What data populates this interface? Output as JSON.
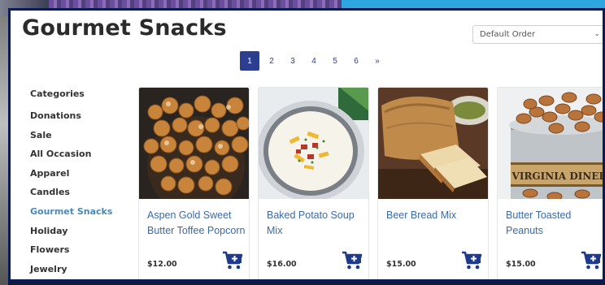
{
  "header": {
    "title": "Gourmet Snacks",
    "sort_select": {
      "value": "Default Order"
    }
  },
  "pagination": {
    "pages": [
      "1",
      "2",
      "3",
      "4",
      "5",
      "6"
    ],
    "current": "1",
    "next": "»"
  },
  "sidebar": {
    "heading": "Categories",
    "items": [
      {
        "label": "Donations",
        "active": false
      },
      {
        "label": "Sale",
        "active": false
      },
      {
        "label": "All Occasion",
        "active": false
      },
      {
        "label": "Apparel",
        "active": false
      },
      {
        "label": "Candles",
        "active": false
      },
      {
        "label": "Gourmet Snacks",
        "active": true
      },
      {
        "label": "Holiday",
        "active": false
      },
      {
        "label": "Flowers",
        "active": false
      },
      {
        "label": "Jewelry",
        "active": false
      }
    ]
  },
  "products": [
    {
      "name": "Aspen Gold Sweet Butter Toffee Popcorn",
      "price": "$12.00",
      "image": "popcorn-image",
      "cart_icon": "add-to-cart-icon"
    },
    {
      "name": "Baked Potato Soup Mix",
      "price": "$16.00",
      "image": "potato-soup-image",
      "cart_icon": "add-to-cart-icon"
    },
    {
      "name": "Beer Bread Mix",
      "price": "$15.00",
      "image": "beer-bread-image",
      "cart_icon": "add-to-cart-icon"
    },
    {
      "name": "Butter Toasted Peanuts",
      "price": "$15.00",
      "image": "peanuts-tin-image",
      "label_text": "VIRGINIA DINER",
      "cart_icon": "add-to-cart-icon"
    }
  ],
  "colors": {
    "accent": "#2c3e8f",
    "link": "#3b6aa8",
    "active_category": "#4a89b8",
    "frame": "#0d1b55"
  }
}
